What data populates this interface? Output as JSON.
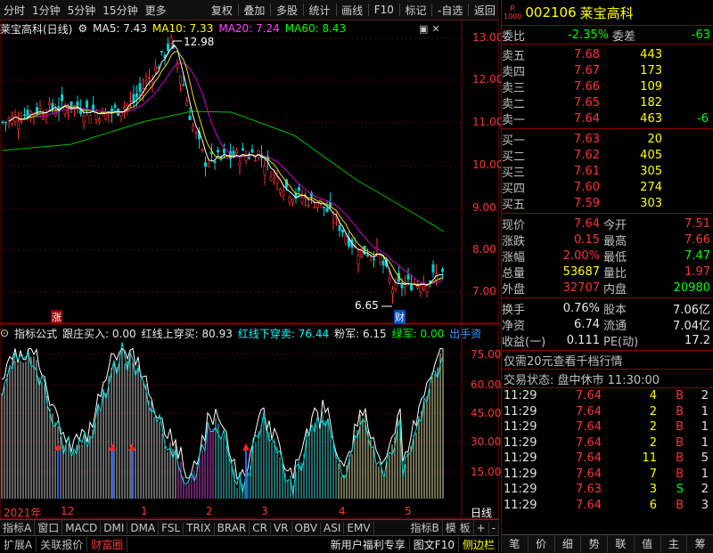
{
  "toolbar": {
    "left_items": [
      "分时",
      "1分钟",
      "5分钟",
      "15分钟",
      "更多"
    ],
    "right_items": [
      "复权",
      "叠加",
      "多股",
      "统计",
      "画线",
      "F10",
      "标记",
      "-自选",
      "返回"
    ]
  },
  "main_chart": {
    "title": "莱宝高科(日线)",
    "ma5": "MA5: 7.43",
    "ma10": "MA10: 7.33",
    "ma20": "MA20: 7.24",
    "ma60": "MA60: 8.43",
    "high_label": "12.98",
    "low_label": "6.65",
    "marker_zhang": "涨",
    "marker_cai": "财",
    "price_ticks": [
      "13.00",
      "12.00",
      "11.00",
      "10.00",
      "9.00",
      "8.00",
      "7.00"
    ]
  },
  "indicator": {
    "legend": [
      "指标公式",
      "跟庄买入: 0.00",
      "红线上穿买: 80.93",
      "红线下穿卖: 76.44",
      "粉军: 6.15",
      "绿军: 0.00",
      "出手资"
    ],
    "ticks": [
      "75.00",
      "60.00",
      "45.00",
      "30.00",
      "15.00"
    ]
  },
  "date_axis": [
    "2021年",
    "12",
    "1",
    "2",
    "3",
    "4",
    "5"
  ],
  "date_axis_right": "日线",
  "bottom_tabs": [
    "指标A",
    "窗口",
    "MACD",
    "DMI",
    "DMA",
    "FSL",
    "TRIX",
    "BRAR",
    "CR",
    "VR",
    "OBV",
    "ASI",
    "EMV",
    "指标B",
    "模 板",
    "+",
    "-"
  ],
  "status_bar": [
    "扩展A",
    "关联报价",
    "财富圈",
    "新用户福利专享",
    "图文F10",
    "侧边栏"
  ],
  "quote": {
    "code": "002106",
    "name": "莱宝高科",
    "badge_top": "R",
    "badge_bottom": "1000",
    "weibi_label": "委比",
    "weibi": "-2.35%",
    "weicha_label": "委差",
    "weicha": "-63",
    "asks": [
      {
        "label": "卖五",
        "price": "7.68",
        "vol": "443",
        "chg": ""
      },
      {
        "label": "卖四",
        "price": "7.67",
        "vol": "173",
        "chg": ""
      },
      {
        "label": "卖三",
        "price": "7.66",
        "vol": "109",
        "chg": ""
      },
      {
        "label": "卖二",
        "price": "7.65",
        "vol": "182",
        "chg": ""
      },
      {
        "label": "卖一",
        "price": "7.64",
        "vol": "463",
        "chg": "-6"
      }
    ],
    "bids": [
      {
        "label": "买一",
        "price": "7.63",
        "vol": "20",
        "chg": ""
      },
      {
        "label": "买二",
        "price": "7.62",
        "vol": "405",
        "chg": ""
      },
      {
        "label": "买三",
        "price": "7.61",
        "vol": "305",
        "chg": ""
      },
      {
        "label": "买四",
        "price": "7.60",
        "vol": "274",
        "chg": ""
      },
      {
        "label": "买五",
        "price": "7.59",
        "vol": "303",
        "chg": ""
      }
    ],
    "stats": [
      {
        "l1": "现价",
        "v1": "7.64",
        "l2": "今开",
        "v2": "7.51"
      },
      {
        "l1": "涨跌",
        "v1": "0.15",
        "l2": "最高",
        "v2": "7.66"
      },
      {
        "l1": "涨幅",
        "v1": "2.00%",
        "l2": "最低",
        "v2": "7.47"
      },
      {
        "l1": "总量",
        "v1": "53687",
        "l2": "量比",
        "v2": "1.97"
      },
      {
        "l1": "外盘",
        "v1": "32707",
        "l2": "内盘",
        "v2": "20980"
      }
    ],
    "stats2": [
      {
        "l1": "换手",
        "v1": "0.76%",
        "l2": "股本",
        "v2": "7.06亿"
      },
      {
        "l1": "净资",
        "v1": "6.74",
        "l2": "流通",
        "v2": "7.04亿"
      },
      {
        "l1": "收益(一)",
        "v1": "0.111",
        "l2": "PE(动)",
        "v2": "17.2"
      }
    ],
    "promo": "仅需20元查看千档行情",
    "trade_state": "交易状态: 盘中休市 11:30:00",
    "ticks": [
      {
        "time": "11:29",
        "price": "7.64",
        "vol": "4",
        "bs": "B",
        "n": "2"
      },
      {
        "time": "11:29",
        "price": "7.64",
        "vol": "2",
        "bs": "B",
        "n": "1"
      },
      {
        "time": "11:29",
        "price": "7.64",
        "vol": "2",
        "bs": "B",
        "n": "1"
      },
      {
        "time": "11:29",
        "price": "7.64",
        "vol": "2",
        "bs": "B",
        "n": "1"
      },
      {
        "time": "11:29",
        "price": "7.64",
        "vol": "11",
        "bs": "B",
        "n": "5"
      },
      {
        "time": "11:29",
        "price": "7.64",
        "vol": "7",
        "bs": "B",
        "n": "1"
      },
      {
        "time": "11:29",
        "price": "7.63",
        "vol": "3",
        "bs": "S",
        "n": "2"
      },
      {
        "time": "11:29",
        "price": "7.64",
        "vol": "6",
        "bs": "B",
        "n": "3"
      }
    ],
    "tabs": [
      "笔",
      "价",
      "细",
      "势",
      "联",
      "值",
      "主",
      "筹"
    ]
  }
}
